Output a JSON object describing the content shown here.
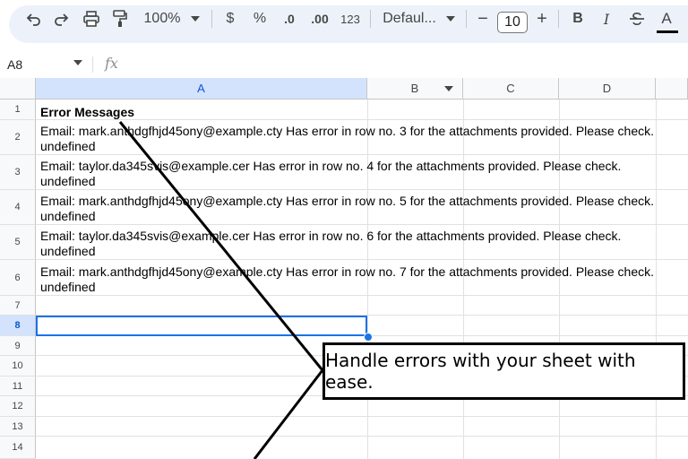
{
  "toolbar": {
    "zoom": "100%",
    "currency": "$",
    "percent": "%",
    "decrease_decimal": ".0",
    "increase_decimal": ".00",
    "number_format": "123",
    "font": "Defaul...",
    "minus": "−",
    "font_size": "10",
    "plus": "+",
    "bold": "B",
    "italic": "I",
    "text_color": "A",
    "icons": [
      "undo-icon",
      "redo-icon",
      "print-icon",
      "paint-format-icon",
      "zoom-dropdown-icon",
      "font-dropdown-icon",
      "strikethrough-icon"
    ]
  },
  "formula_bar": {
    "cell_ref": "A8",
    "fx": "fx"
  },
  "columns": [
    "A",
    "B",
    "C",
    "D"
  ],
  "rows": [
    "1",
    "2",
    "3",
    "4",
    "5",
    "6",
    "7",
    "8",
    "9",
    "10",
    "11",
    "12",
    "13",
    "14"
  ],
  "selected_row": "8",
  "cells": {
    "r1": "Error Messages",
    "r2": "Email: mark.anthdgfhjd45ony@example.cty Has error in row no. 3 for the attachments provided. Please check.\nundefined",
    "r3": "Email: taylor.da345svis@example.cer Has error in row no. 4 for the attachments provided. Please check.\nundefined",
    "r4": "Email: mark.anthdgfhjd45ony@example.cty Has error in row no. 5 for the attachments provided. Please check.\nundefined",
    "r5": "Email: taylor.da345svis@example.cer Has error in row no. 6 for the attachments provided. Please check.\nundefined",
    "r6": "Email: mark.anthdgfhjd45ony@example.cty Has error in row no. 7 for the attachments provided. Please check.\nundefined"
  },
  "callout": {
    "text": "Handle errors with your sheet with ease."
  },
  "colors": {
    "selection": "#1a73e8",
    "toolbar_bg": "#edf2fa",
    "header_bg": "#f8f9fa",
    "selected_header_bg": "#d3e3fd"
  }
}
